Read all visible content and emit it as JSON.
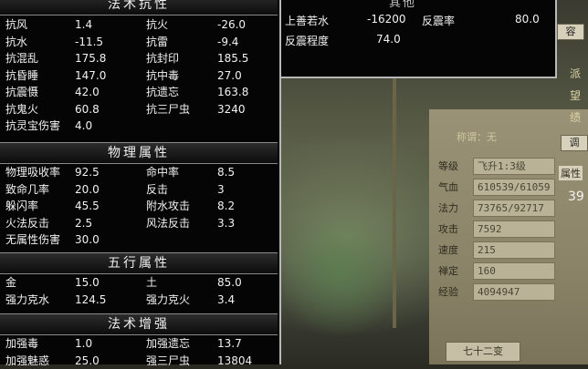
{
  "sections": {
    "magic_resist": {
      "title": "法术抗性",
      "rows": [
        {
          "l1": "抗风",
          "v1": "1.4",
          "l2": "抗火",
          "v2": "-26.0"
        },
        {
          "l1": "抗水",
          "v1": "-11.5",
          "l2": "抗雷",
          "v2": "-9.4"
        },
        {
          "l1": "抗混乱",
          "v1": "175.8",
          "l2": "抗封印",
          "v2": "185.5"
        },
        {
          "l1": "抗昏睡",
          "v1": "147.0",
          "l2": "抗中毒",
          "v2": "27.0"
        },
        {
          "l1": "抗震慑",
          "v1": "42.0",
          "l2": "抗遗忘",
          "v2": "163.8"
        },
        {
          "l1": "抗鬼火",
          "v1": "60.8",
          "l2": "抗三尸虫",
          "v2": "3240"
        },
        {
          "l1": "抗灵宝伤害",
          "v1": "4.0",
          "l2": "",
          "v2": ""
        }
      ]
    },
    "physical": {
      "title": "物理属性",
      "rows": [
        {
          "l1": "物理吸收率",
          "v1": "92.5",
          "l2": "命中率",
          "v2": "8.5"
        },
        {
          "l1": "致命几率",
          "v1": "20.0",
          "l2": "反击",
          "v2": "3"
        },
        {
          "l1": "躲闪率",
          "v1": "45.5",
          "l2": "附水攻击",
          "v2": "8.2"
        },
        {
          "l1": "火法反击",
          "v1": "2.5",
          "l2": "风法反击",
          "v2": "3.3"
        },
        {
          "l1": "无属性伤害",
          "v1": "30.0",
          "l2": "",
          "v2": ""
        }
      ]
    },
    "five_elements": {
      "title": "五行属性",
      "rows": [
        {
          "l1": "金",
          "v1": "15.0",
          "l2": "土",
          "v2": "85.0"
        },
        {
          "l1": "强力克水",
          "v1": "124.5",
          "l2": "强力克火",
          "v2": "3.4"
        }
      ]
    },
    "magic_boost": {
      "title": "法术增强",
      "rows": [
        {
          "l1": "加强毒",
          "v1": "1.0",
          "l2": "加强遗忘",
          "v2": "13.7"
        },
        {
          "l1": "加强魅惑",
          "v1": "25.0",
          "l2": "强三尸虫",
          "v2": "13804"
        }
      ]
    }
  },
  "extra": {
    "title": "其他",
    "row1": {
      "l1": "上善若水",
      "v1": "-16200",
      "l2": "反震率",
      "v2": "80.0"
    },
    "row2": {
      "l1": "反震程度",
      "v1": "74.0"
    }
  },
  "character": {
    "top_label": "称谓：无",
    "rows": [
      {
        "label": "等级",
        "value": "飞升1:3级"
      },
      {
        "label": "气血",
        "value": "610539/61059"
      },
      {
        "label": "法力",
        "value": "73765/92717"
      },
      {
        "label": "攻击",
        "value": "7592"
      },
      {
        "label": "速度",
        "value": "215"
      },
      {
        "label": "禅定",
        "value": "160"
      },
      {
        "label": "经验",
        "value": "4094947"
      }
    ],
    "bottom_button": "七十二变",
    "side_buttons": [
      "容",
      "调"
    ],
    "side_chars": [
      "派",
      "望",
      "绩"
    ],
    "side_number": "39",
    "side_text": "属性"
  }
}
